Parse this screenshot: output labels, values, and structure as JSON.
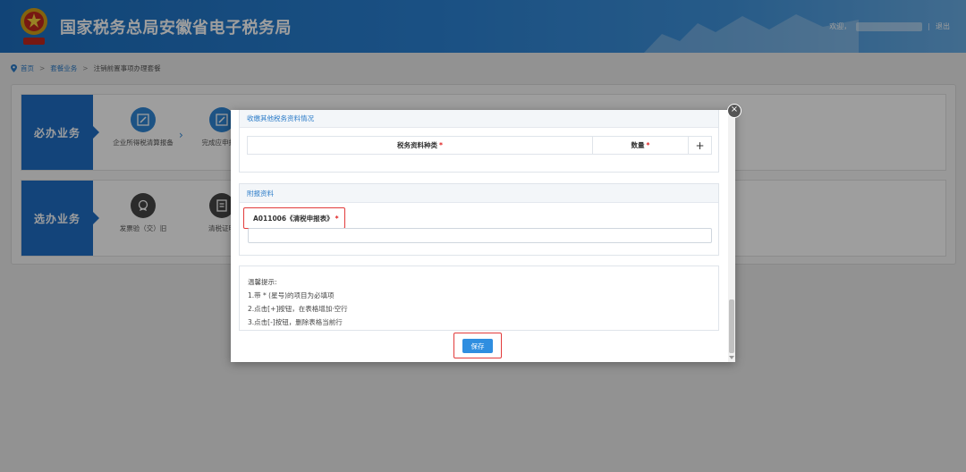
{
  "header": {
    "title": "国家税务总局安徽省电子税务局",
    "welcome": "欢迎，",
    "separator": "|",
    "logout": "退出",
    "emblem_icon": "national-tax-emblem-icon",
    "brand_color": "#1c6fc0"
  },
  "breadcrumb": {
    "icon": "location-pin-icon",
    "items": [
      "首页",
      "套餐业务",
      "注销前置事项办理套餐"
    ],
    "arrow": ">"
  },
  "main": {
    "row1": {
      "label": "必办业务",
      "tasks": [
        {
          "label": "企业所得税清算报备",
          "icon": "edit-form-icon"
        },
        {
          "label": "完成应申报款",
          "icon": "edit-form-icon"
        }
      ]
    },
    "row2": {
      "label": "选办业务",
      "tasks": [
        {
          "label": "发票验（交）旧",
          "icon": "badge-icon"
        },
        {
          "label": "清税证明",
          "icon": "document-icon"
        }
      ]
    }
  },
  "modal": {
    "section1": {
      "title": "收缴其他税务资料情况",
      "columns": [
        "税务资料种类",
        "数量"
      ],
      "add_button": "+"
    },
    "section2": {
      "title": "附报资料",
      "field_label": "A011006《清税申报表》",
      "field_value": ""
    },
    "tips": {
      "title": "温馨提示:",
      "lines": [
        "1.带 * (星号)的项目为必填项",
        "2.点击[+]按钮，在表格增加·空行",
        "3.点击[-]按钮，删除表格当前行"
      ]
    },
    "save_button": "保存",
    "close_icon": "close-icon"
  }
}
